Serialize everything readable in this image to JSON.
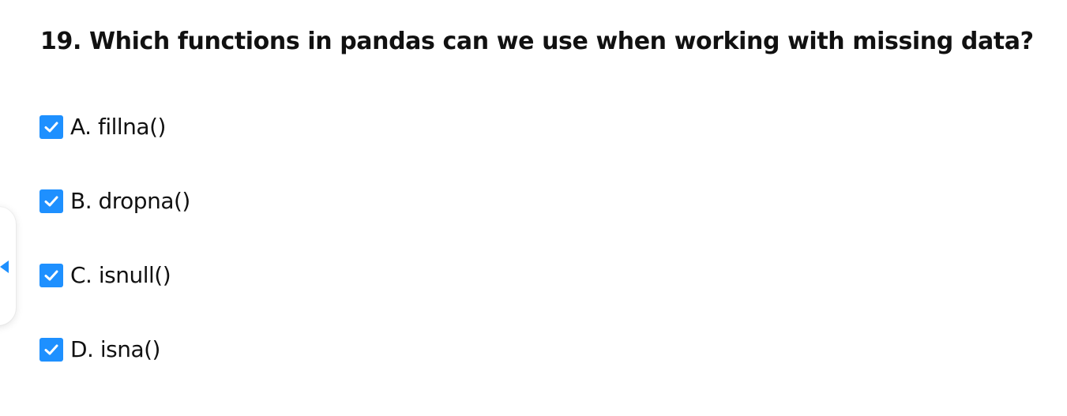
{
  "question": {
    "title": "19. Which functions in pandas can we use when working with missing data?"
  },
  "options": [
    {
      "label": "A. fillna()",
      "checked": true
    },
    {
      "label": "B. dropna()",
      "checked": true
    },
    {
      "label": "C. isnull()",
      "checked": true
    },
    {
      "label": "D. isna()",
      "checked": true
    }
  ],
  "colors": {
    "checkbox": "#1e90ff",
    "accent": "#1e90ff"
  },
  "icons": {
    "checkbox_check": "check-icon",
    "side_toggle": "caret-left-icon"
  }
}
